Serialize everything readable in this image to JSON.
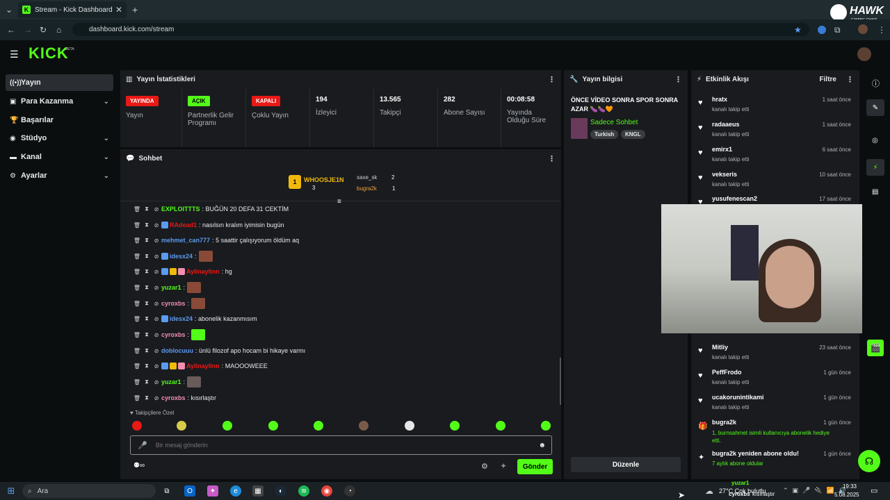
{
  "browser": {
    "tab_title": "Stream - Kick Dashboard",
    "url": "dashboard.kick.com/stream",
    "watermark_text": "HAWK",
    "watermark_sub": "GAMING CHAIR"
  },
  "kick": {
    "logo": "KICK",
    "beta": "BETA"
  },
  "sidebar": {
    "items": [
      {
        "label": "Yayın",
        "icon": "broadcast-icon"
      },
      {
        "label": "Para Kazanma",
        "icon": "money-icon"
      },
      {
        "label": "Başarılar",
        "icon": "trophy-icon"
      },
      {
        "label": "Stüdyo",
        "icon": "studio-icon"
      },
      {
        "label": "Kanal",
        "icon": "channel-icon"
      },
      {
        "label": "Ayarlar",
        "icon": "gear-icon"
      }
    ]
  },
  "stats": {
    "title": "Yayın İstatistikleri",
    "items": [
      {
        "badge": "YAYINDA",
        "label": "Yayın",
        "color": "#e91916"
      },
      {
        "badge": "AÇIK",
        "label": "Partnerlik Gelir Programı",
        "color": "#53fc18"
      },
      {
        "badge": "KAPALI",
        "label": "Çoklu Yayın",
        "color": "#e91916"
      },
      {
        "value": "194",
        "label": "İzleyici"
      },
      {
        "value": "13.565",
        "label": "Takipçi"
      },
      {
        "value": "282",
        "label": "Abone Sayısı"
      },
      {
        "value": "00:08:58",
        "label": "Yayında Olduğu Süre"
      }
    ]
  },
  "chat": {
    "title": "Sohbet",
    "leaders": [
      {
        "rank": "1",
        "name": "WHOOSJE1N",
        "count": "3"
      },
      {
        "name": "xaxe_sk",
        "count": "2"
      },
      {
        "name": "bugra2k",
        "count": "1"
      }
    ],
    "messages": [
      {
        "user": "EXPLOITTTS",
        "text": "BUĞÜN 20 DEFA 31 CEKTİM",
        "color": "#53fc18"
      },
      {
        "user": "RAdead1",
        "text": "nasılsın kralım iyimisin bugün",
        "color": "#e91916"
      },
      {
        "user": "mehmet_can777",
        "text": "5 saattir çalışıyorum öldüm aq",
        "color": "#5b9bf0"
      },
      {
        "user": "idesx24",
        "text": "",
        "color": "#5b9bf0"
      },
      {
        "user": "Aylinaylinn",
        "text": "hg",
        "color": "#e91916"
      },
      {
        "user": "yuzar1",
        "text": "",
        "color": "#53fc18"
      },
      {
        "user": "cyroxbs",
        "text": "",
        "color": "#f28fb0"
      },
      {
        "user": "idesx24",
        "text": "abonelik kazanmısım",
        "color": "#5b9bf0"
      },
      {
        "user": "cyroxbs",
        "text": "",
        "color": "#f28fb0"
      },
      {
        "user": "doblocuuu",
        "text": "ünlü filozof apo hocam bi hikaye varmı",
        "color": "#5b9bf0"
      },
      {
        "user": "Aylinaylinn",
        "text": "MAOOOWEEE",
        "color": "#e91916"
      },
      {
        "user": "yuzar1",
        "text": "",
        "color": "#53fc18"
      },
      {
        "user": "cyroxbs",
        "text": "kısırlaştır",
        "color": "#f28fb0"
      }
    ],
    "followers_only": "Takipçilere Özel",
    "input_placeholder": "Bir mesaj gönderin",
    "send_label": "Gönder"
  },
  "stream_info": {
    "title": "Yayın bilgisi",
    "stream_title": "ÖNCE VİDEO SONRA SPOR SONRA AZAR 🍆🍆🧡",
    "category": "Sadece Sohbet",
    "tags": [
      "Turkish",
      "KNGL"
    ],
    "edit_label": "Düzenle"
  },
  "activity": {
    "title": "Etkinlik Akışı",
    "filter_label": "Filtre",
    "items": [
      {
        "name": "hratx",
        "sub": "kanalı takip etti",
        "time": "1 saat önce"
      },
      {
        "name": "radaaeus",
        "sub": "kanalı takip etti",
        "time": "1 saat önce"
      },
      {
        "name": "emirx1",
        "sub": "kanalı takip etti",
        "time": "6 saat önce"
      },
      {
        "name": "vekseris",
        "sub": "kanalı takip etti",
        "time": "10 saat önce"
      },
      {
        "name": "yusufenescan2",
        "sub": "",
        "time": "17 saat önce"
      },
      {
        "name": "Mitliy",
        "sub": "kanalı takip etti",
        "time": "23 saat önce"
      },
      {
        "name": "PeffFrodo",
        "sub": "kanalı takip etti",
        "time": "1 gün önce"
      },
      {
        "name": "ucakorunintikami",
        "sub": "kanalı takip etti",
        "time": "1 gün önce"
      },
      {
        "name": "bugra2k",
        "sub": "1, burnsahmet isimli kullanıcıya abonelik hediye etti.",
        "time": "1 gün önce"
      },
      {
        "name": "bugra2k yeniden abone oldu!",
        "sub": "7 aylık abone oldular",
        "time": "1 gün önce"
      }
    ]
  },
  "taskbar": {
    "search": "Ara",
    "weather": "27°C Çok bulutlu",
    "time": "19:33",
    "date": "5.08.2025",
    "overlay_user": "yuzar1",
    "overlay_user2": "cyroxbs",
    "overlay_text": "kısırlaştır"
  }
}
